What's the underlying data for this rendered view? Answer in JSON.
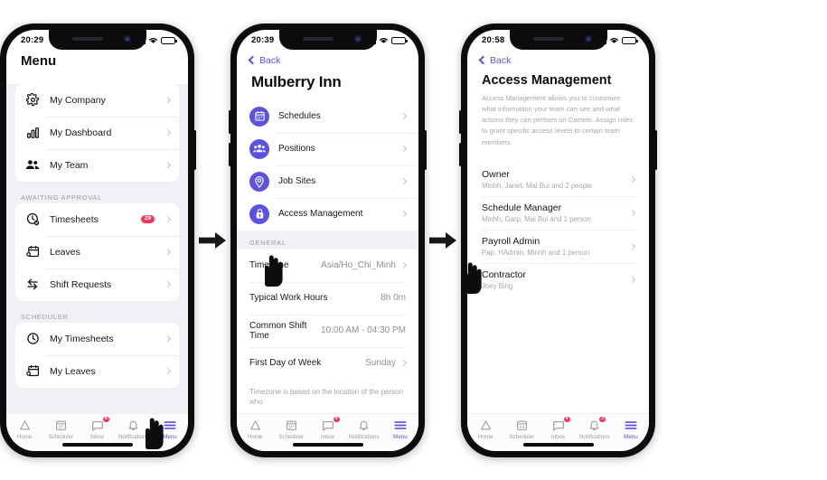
{
  "colors": {
    "accent": "#5b52e0",
    "link": "#5b54e8",
    "badge": "#f4365d",
    "page_bg": "#f1f1f5",
    "muted": "#a6a6ae"
  },
  "arrow_glyph": "arrow-right-icon",
  "phone1": {
    "status": {
      "time": "20:29",
      "signal": "signal-bars-icon",
      "wifi": "wifi-icon",
      "battery": "battery-icon"
    },
    "title": "Menu",
    "groups": [
      {
        "label": "",
        "items": [
          {
            "label": "My Company",
            "icon": "gear-icon",
            "badge": ""
          },
          {
            "label": "My Dashboard",
            "icon": "bar-chart-icon",
            "badge": ""
          },
          {
            "label": "My Team",
            "icon": "people-icon",
            "badge": ""
          }
        ]
      },
      {
        "label": "AWAITING APPROVAL",
        "items": [
          {
            "label": "Timesheets",
            "icon": "clock-check-icon",
            "badge": "29"
          },
          {
            "label": "Leaves",
            "icon": "calendar-add-icon",
            "badge": ""
          },
          {
            "label": "Shift Requests",
            "icon": "swap-arrows-icon",
            "badge": ""
          }
        ]
      },
      {
        "label": "SCHEDULER",
        "items": [
          {
            "label": "My Timesheets",
            "icon": "clock-icon",
            "badge": ""
          },
          {
            "label": "My Leaves",
            "icon": "calendar-add-icon",
            "badge": ""
          }
        ]
      }
    ],
    "tabs": [
      {
        "label": "Home",
        "icon": "home-icon",
        "badge": "",
        "active": false
      },
      {
        "label": "Scheduler",
        "icon": "scheduler-icon",
        "badge": "",
        "active": false
      },
      {
        "label": "Inbox",
        "icon": "inbox-icon",
        "badge": "9",
        "active": false
      },
      {
        "label": "Notifications",
        "icon": "bell-icon",
        "badge": "",
        "active": false
      },
      {
        "label": "Menu",
        "icon": "hamburger-icon",
        "badge": "",
        "active": true
      }
    ]
  },
  "phone2": {
    "status": {
      "time": "20:39"
    },
    "back_label": "Back",
    "title": "Mulberry Inn",
    "menu_items": [
      {
        "label": "Schedules",
        "icon": "calendar-icon"
      },
      {
        "label": "Positions",
        "icon": "people-icon"
      },
      {
        "label": "Job Sites",
        "icon": "location-pin-icon"
      },
      {
        "label": "Access Management",
        "icon": "lock-icon"
      }
    ],
    "section_label": "GENERAL",
    "settings": [
      {
        "key": "Timezone",
        "value": "Asia/Ho_Chi_Minh",
        "chevron": true
      },
      {
        "key": "Typical Work Hours",
        "value": "8h 0m",
        "chevron": false
      },
      {
        "key": "Common Shift Time",
        "value": "10:00 AM  -  04:30 PM",
        "chevron": false
      },
      {
        "key": "First Day of Week",
        "value": "Sunday",
        "chevron": true
      }
    ],
    "footnote": "Timezone is based on the location of the person who",
    "tabs": [
      {
        "label": "Home",
        "icon": "home-icon",
        "badge": "",
        "active": false
      },
      {
        "label": "Scheduler",
        "icon": "scheduler-icon",
        "badge": "",
        "active": false
      },
      {
        "label": "Inbox",
        "icon": "inbox-icon",
        "badge": "9",
        "active": false
      },
      {
        "label": "Notifications",
        "icon": "bell-icon",
        "badge": "",
        "active": false
      },
      {
        "label": "Menu",
        "icon": "hamburger-icon",
        "badge": "",
        "active": true
      }
    ]
  },
  "phone3": {
    "status": {
      "time": "20:58"
    },
    "back_label": "Back",
    "title": "Access Management",
    "description": "Access Management allows you to customize what information your team can see and what actions they can perform on Camelo. Assign roles to grant specific access levels to certain team members.",
    "roles": [
      {
        "name": "Owner",
        "members": "Minhh, Janet, Mai Bui and 2 people"
      },
      {
        "name": "Schedule Manager",
        "members": "Minhh, Garp, Mai Bui and 1 person"
      },
      {
        "name": "Payroll Admin",
        "members": "Pap, HAdmin, Minhh and 1 person"
      },
      {
        "name": "Contractor",
        "members": "Joey Bing"
      }
    ],
    "tabs": [
      {
        "label": "Home",
        "icon": "home-icon",
        "badge": "",
        "active": false
      },
      {
        "label": "Scheduler",
        "icon": "scheduler-icon",
        "badge": "",
        "active": false
      },
      {
        "label": "Inbox",
        "icon": "inbox-icon",
        "badge": "9",
        "active": false
      },
      {
        "label": "Notifications",
        "icon": "bell-icon",
        "badge": "1",
        "active": false
      },
      {
        "label": "Menu",
        "icon": "hamburger-icon",
        "badge": "",
        "active": true
      }
    ]
  }
}
